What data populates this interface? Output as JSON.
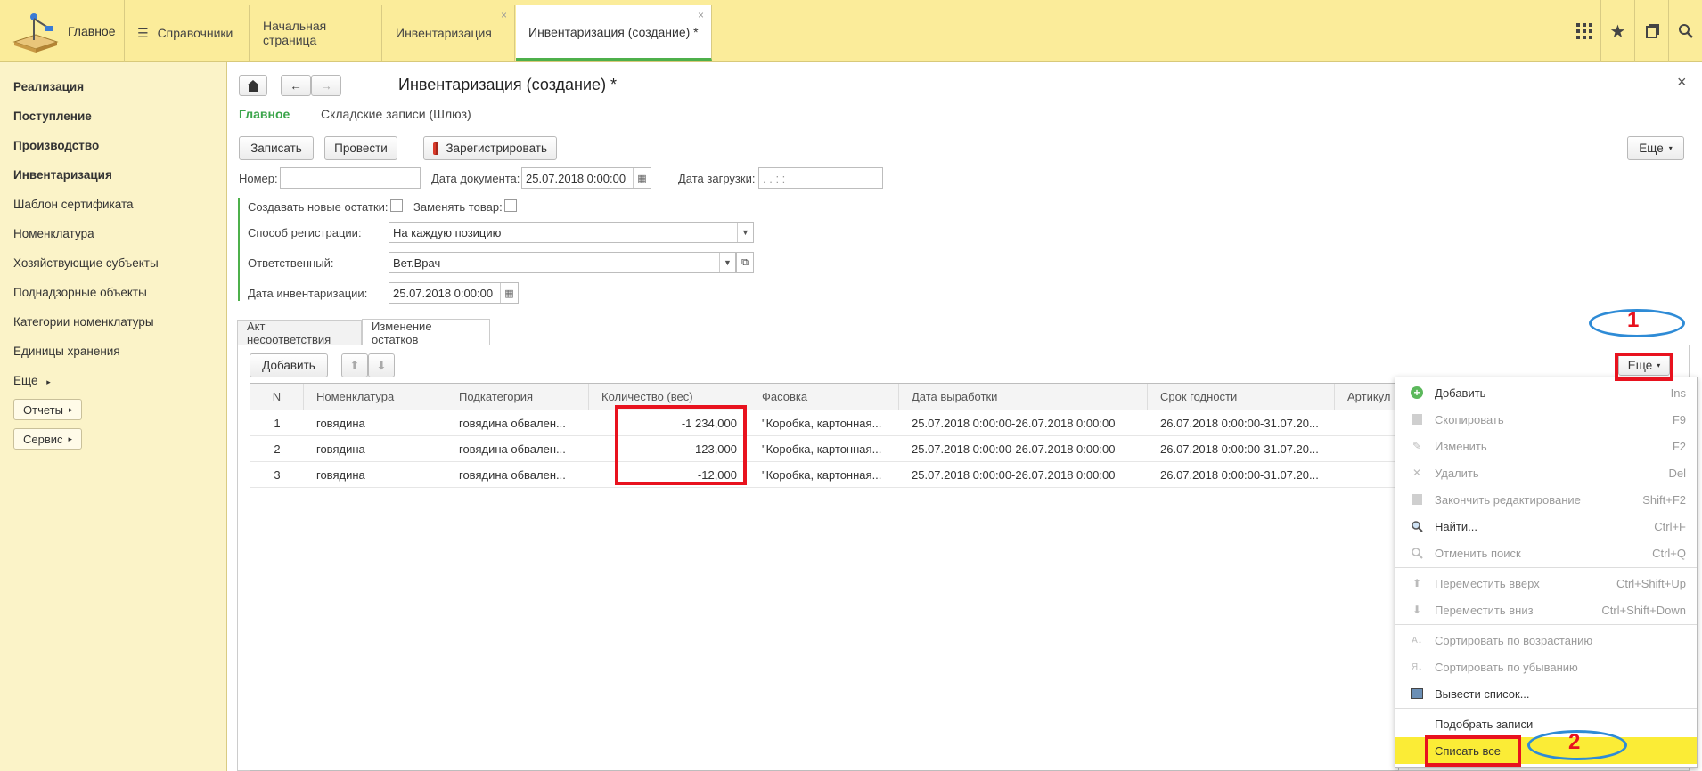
{
  "topbar": {
    "home_label": "Главное",
    "tabs": [
      {
        "label": "Справочники"
      },
      {
        "label": "Начальная страница"
      },
      {
        "label": "Инвентаризация"
      },
      {
        "label": "Инвентаризация (создание) *"
      }
    ],
    "close_glyph": "×",
    "tools": [
      "apps-icon",
      "star-icon",
      "history-icon",
      "search-icon"
    ]
  },
  "sidebar": {
    "items": [
      {
        "label": "Реализация",
        "bold": true
      },
      {
        "label": "Поступление",
        "bold": true
      },
      {
        "label": "Производство",
        "bold": true
      },
      {
        "label": "Инвентаризация",
        "bold": true
      },
      {
        "label": "Шаблон сертификата",
        "bold": false
      },
      {
        "label": "Номенклатура",
        "bold": false
      },
      {
        "label": "Хозяйствующие субъекты",
        "bold": false
      },
      {
        "label": "Поднадзорные объекты",
        "bold": false
      },
      {
        "label": "Категории номенклатуры",
        "bold": false
      },
      {
        "label": "Единицы хранения",
        "bold": false
      },
      {
        "label": "Еще",
        "bold": false
      }
    ],
    "buttons": [
      {
        "label": "Отчеты"
      },
      {
        "label": "Сервис"
      }
    ]
  },
  "form": {
    "title": "Инвентаризация (создание) *",
    "close_glyph": "×",
    "nav": {
      "main": "Главное",
      "warehouse": "Складские записи (Шлюз)"
    },
    "buttons": {
      "save": "Записать",
      "post": "Провести",
      "register": "Зарегистрировать",
      "more": "Еще"
    },
    "fields": {
      "number_label": "Номер:",
      "number_value": "",
      "doc_date_label": "Дата документа:",
      "doc_date_value": "25.07.2018  0:00:00",
      "load_date_label": "Дата загрузки:",
      "load_date_value": " .  .       :  :",
      "create_remains_label": "Создавать новые остатки:",
      "replace_goods_label": "Заменять товар:",
      "reg_method_label": "Способ регистрации:",
      "reg_method_value": "На каждую позицию",
      "responsible_label": "Ответственный:",
      "responsible_value": "Вет.Врач",
      "inv_date_label": "Дата инвентаризации:",
      "inv_date_value": "25.07.2018  0:00:00"
    },
    "tabs": [
      {
        "label": "Акт несоответствия"
      },
      {
        "label": "Изменение остатков"
      }
    ],
    "table_toolbar": {
      "add": "Добавить",
      "more": "Еще"
    }
  },
  "table": {
    "columns": [
      "N",
      "Номенклатура",
      "Подкатегория",
      "Количество (вес)",
      "Фасовка",
      "Дата выработки",
      "Срок годности",
      "Артикул"
    ],
    "rows": [
      {
        "n": "1",
        "nom": "говядина",
        "sub": "говядина обвален...",
        "qty": "-1 234,000",
        "pack": "\"Коробка, картонная...",
        "prod": "25.07.2018 0:00:00-26.07.2018 0:00:00",
        "exp": "26.07.2018 0:00:00-31.07.20..."
      },
      {
        "n": "2",
        "nom": "говядина",
        "sub": "говядина обвален...",
        "qty": "-123,000",
        "pack": "\"Коробка, картонная...",
        "prod": "25.07.2018 0:00:00-26.07.2018 0:00:00",
        "exp": "26.07.2018 0:00:00-31.07.20..."
      },
      {
        "n": "3",
        "nom": "говядина",
        "sub": "говядина обвален...",
        "qty": "-12,000",
        "pack": "\"Коробка, картонная...",
        "prod": "25.07.2018 0:00:00-26.07.2018 0:00:00",
        "exp": "26.07.2018 0:00:00-31.07.20..."
      }
    ]
  },
  "menu": {
    "items": [
      {
        "label": "Добавить",
        "shortcut": "Ins",
        "enabled": true,
        "icon": "add-icon"
      },
      {
        "label": "Скопировать",
        "shortcut": "F9",
        "enabled": false,
        "icon": "copy-icon"
      },
      {
        "label": "Изменить",
        "shortcut": "F2",
        "enabled": false,
        "icon": "edit-icon"
      },
      {
        "label": "Удалить",
        "shortcut": "Del",
        "enabled": false,
        "icon": "delete-icon"
      },
      {
        "label": "Закончить редактирование",
        "shortcut": "Shift+F2",
        "enabled": false,
        "icon": "end-edit-icon"
      },
      {
        "label": "Найти...",
        "shortcut": "Ctrl+F",
        "enabled": true,
        "icon": "find-icon"
      },
      {
        "label": "Отменить поиск",
        "shortcut": "Ctrl+Q",
        "enabled": false,
        "icon": "cancel-search-icon"
      },
      {
        "label": "Переместить вверх",
        "shortcut": "Ctrl+Shift+Up",
        "enabled": false,
        "icon": "move-up-icon"
      },
      {
        "label": "Переместить вниз",
        "shortcut": "Ctrl+Shift+Down",
        "enabled": false,
        "icon": "move-down-icon"
      },
      {
        "label": "Сортировать по возрастанию",
        "shortcut": "",
        "enabled": false,
        "icon": "sort-asc-icon"
      },
      {
        "label": "Сортировать по убыванию",
        "shortcut": "",
        "enabled": false,
        "icon": "sort-desc-icon"
      },
      {
        "label": "Вывести список...",
        "shortcut": "",
        "enabled": true,
        "icon": "output-list-icon"
      },
      {
        "label": "Подобрать записи",
        "shortcut": "",
        "enabled": true,
        "icon": ""
      },
      {
        "label": "Списать все",
        "shortcut": "",
        "enabled": true,
        "icon": ""
      }
    ]
  },
  "annotations": {
    "one": "1",
    "two": "2",
    "red": "#e8121e",
    "blue": "#2e8bd6"
  }
}
